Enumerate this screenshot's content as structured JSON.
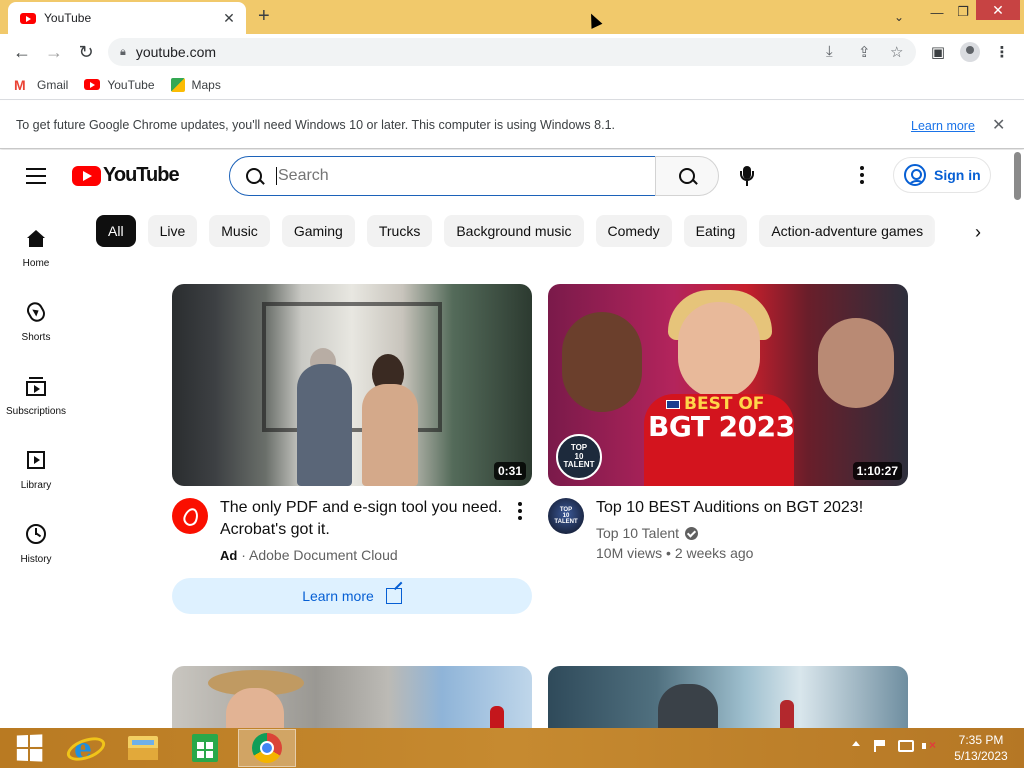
{
  "browser": {
    "tab_title": "YouTube",
    "new_tab_symbol": "+",
    "url": "youtube.com",
    "window_controls": {
      "minimize": "—",
      "maximize": "❐",
      "close": "✕",
      "tab_search": "⌄"
    },
    "bookmarks": [
      {
        "label": "Gmail",
        "icon": "gmail-icon"
      },
      {
        "label": "YouTube",
        "icon": "youtube-icon"
      },
      {
        "label": "Maps",
        "icon": "maps-icon"
      }
    ],
    "infobar": {
      "message": "To get future Google Chrome updates, you'll need Windows 10 or later. This computer is using Windows 8.1.",
      "link": "Learn more"
    }
  },
  "youtube": {
    "logo_text": "YouTube",
    "search": {
      "placeholder": "Search",
      "value": ""
    },
    "sign_in_label": "Sign in",
    "chips": [
      "All",
      "Live",
      "Music",
      "Gaming",
      "Trucks",
      "Background music",
      "Comedy",
      "Eating",
      "Action-adventure games"
    ],
    "active_chip": "All",
    "guide": [
      {
        "label": "Home",
        "icon": "home-icon"
      },
      {
        "label": "Shorts",
        "icon": "shorts-icon"
      },
      {
        "label": "Subscriptions",
        "icon": "subscriptions-icon"
      },
      {
        "label": "Library",
        "icon": "library-icon"
      },
      {
        "label": "History",
        "icon": "history-icon"
      }
    ],
    "videos": [
      {
        "title": "The only PDF and e-sign tool you need. Acrobat's got it.",
        "duration": "0:31",
        "ad_label": "Ad",
        "channel": "Adobe Document Cloud",
        "cta": "Learn more"
      },
      {
        "title": "Top 10 BEST Auditions on BGT 2023!",
        "duration": "1:10:27",
        "channel": "Top 10 Talent",
        "views": "10M views",
        "age": "2 weeks ago",
        "thumb_text_line1": "BEST OF",
        "thumb_text_line2": "BGT 2023",
        "badge_text": [
          "TOP",
          "10",
          "TALENT"
        ],
        "avatar_text": [
          "TOP",
          "10",
          "TALENT"
        ]
      }
    ]
  },
  "taskbar": {
    "apps": [
      "start-icon",
      "internet-explorer-icon",
      "file-explorer-icon",
      "store-icon",
      "chrome-icon"
    ],
    "active_app": "chrome-icon",
    "time": "7:35 PM",
    "date": "5/13/2023"
  },
  "colors": {
    "titlebar": "#f1c96b",
    "youtube_red": "#ff0000",
    "link_blue": "#065fd4",
    "taskbar": "#c68a30"
  }
}
